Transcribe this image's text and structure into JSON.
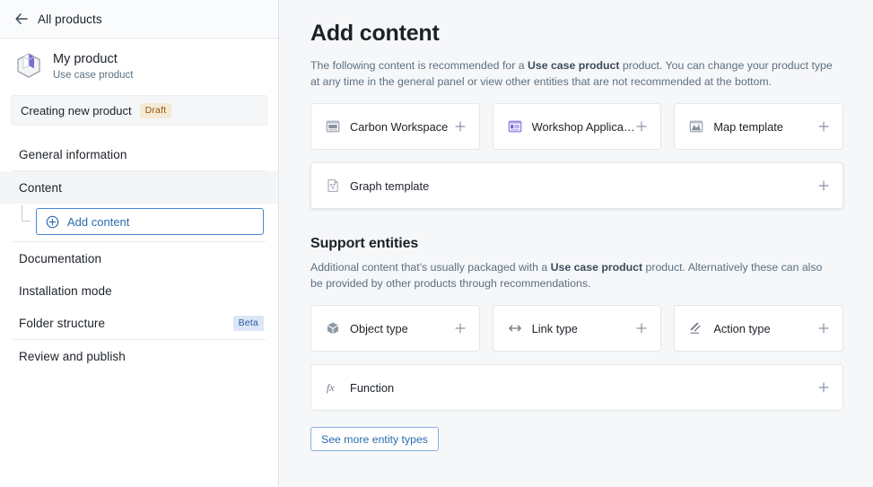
{
  "sidebar": {
    "back_link": {
      "label": "All products",
      "icon": "arrow-left-icon"
    },
    "product": {
      "name": "My product",
      "type": "Use case product",
      "icon": "product-box-icon"
    },
    "status": {
      "text": "Creating new product",
      "badge": "Draft",
      "badge_bg": "#f5ead6",
      "badge_fg": "#935610"
    },
    "nav_items": [
      {
        "label": "General information",
        "active": false,
        "badge": ""
      },
      {
        "label": "Content",
        "active": true,
        "badge": ""
      },
      {
        "label": "Documentation",
        "active": false,
        "badge": ""
      },
      {
        "label": "Installation mode",
        "active": false,
        "badge": ""
      },
      {
        "label": "Folder structure",
        "active": false,
        "badge": "Beta"
      },
      {
        "label": "Review and publish",
        "active": false,
        "badge": ""
      }
    ],
    "sub_item": {
      "label": "Add content",
      "icon": "plus-circle-icon"
    }
  },
  "main": {
    "title": "Add content",
    "description": {
      "part1": "The following content is recommended for a ",
      "bold": "Use case product",
      "part2": " product. You can change your product type at any time in the general panel or view other entities that are not recommended at the bottom."
    },
    "recommended_cards": [
      {
        "label": "Carbon Workspace",
        "icon": "carbon-workspace-icon",
        "plus": "plus-icon"
      },
      {
        "label": "Workshop Application",
        "icon": "workshop-application-icon",
        "plus": "plus-icon"
      },
      {
        "label": "Map template",
        "icon": "map-template-icon",
        "plus": "plus-icon"
      }
    ],
    "recommended_wide_card": {
      "label": "Graph template",
      "icon": "graph-template-icon",
      "plus": "plus-icon"
    },
    "support_section": {
      "title": "Support entities",
      "description": {
        "part1": "Additional content that's usually packaged with a ",
        "bold": "Use case product",
        "part2": " product. Alternatively these can also be provided by other products through recommendations."
      },
      "cards": [
        {
          "label": "Object type",
          "icon": "object-type-icon",
          "plus": "plus-icon"
        },
        {
          "label": "Link type",
          "icon": "link-type-icon",
          "plus": "plus-icon"
        },
        {
          "label": "Action type",
          "icon": "action-type-icon",
          "plus": "plus-icon"
        }
      ],
      "wide_card": {
        "label": "Function",
        "icon": "function-icon",
        "plus": "plus-icon"
      }
    },
    "more_button": {
      "label": "See more entity types"
    }
  },
  "colors": {
    "accent_blue": "#2b6cb0",
    "purple": "#7e6ad6",
    "sidebar_bg": "#ffffff",
    "main_bg": "#f6f7f9",
    "text_primary": "#1c2127",
    "text_muted": "#5c7080"
  }
}
